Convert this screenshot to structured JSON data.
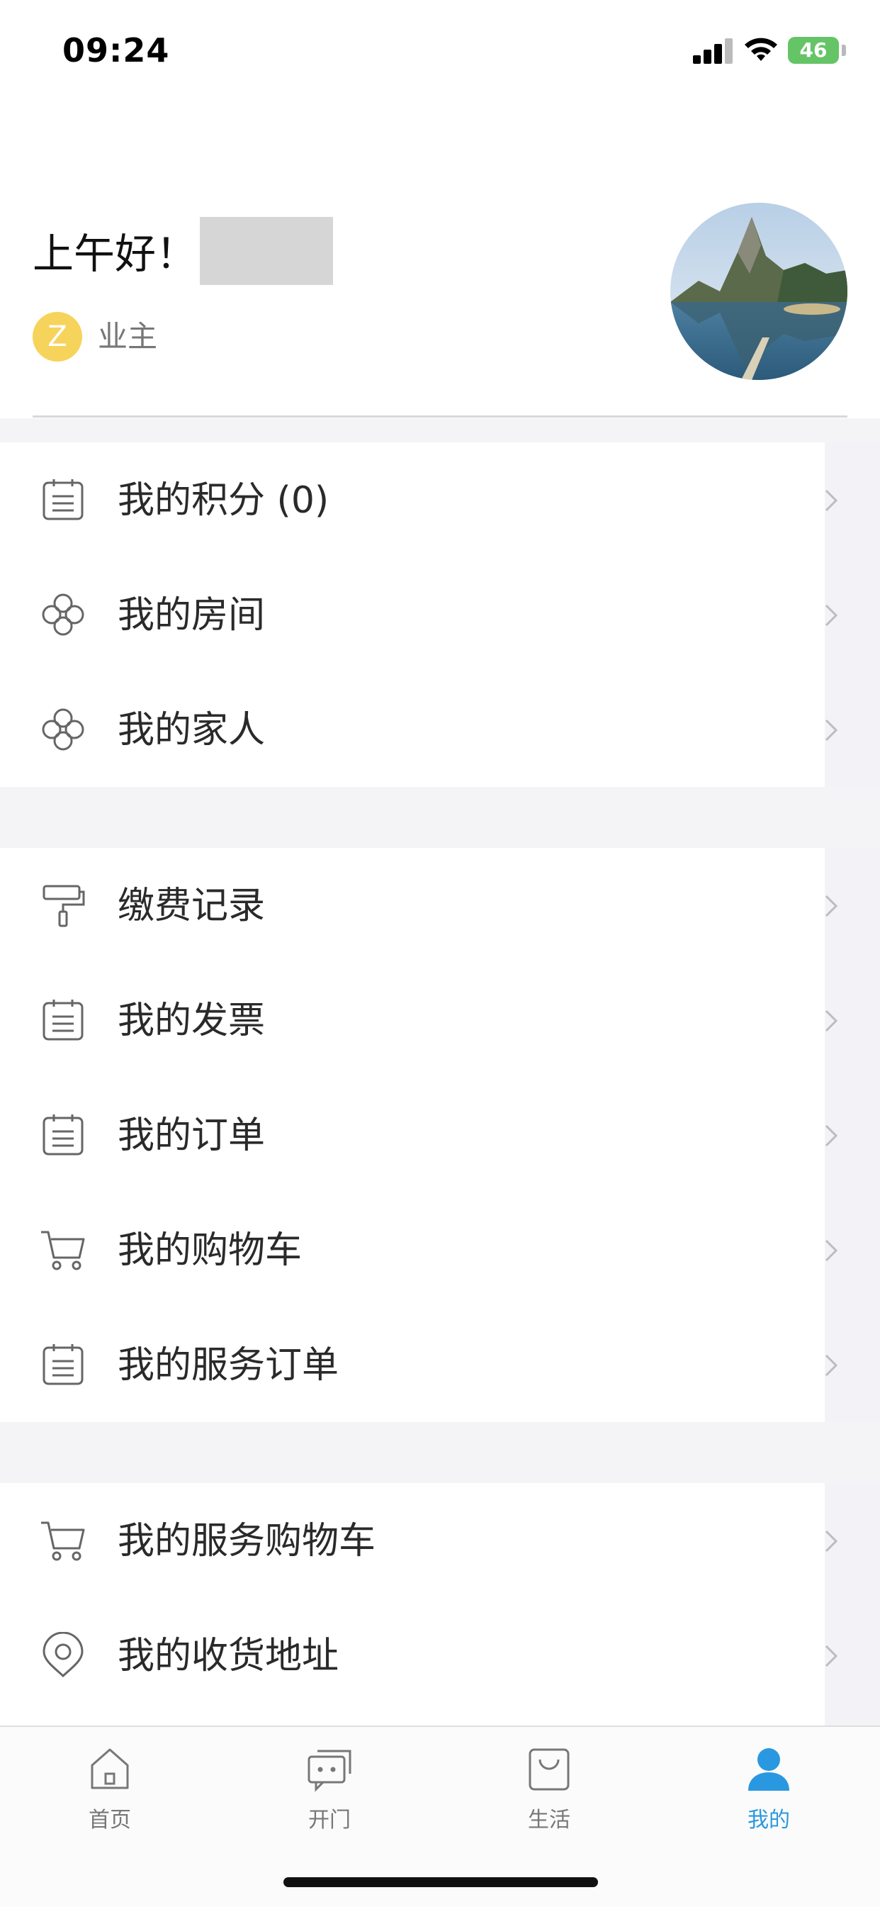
{
  "status_bar": {
    "time": "09:24",
    "battery": "46"
  },
  "header": {
    "greeting": "上午好！",
    "role_badge": "Z",
    "role": "业主"
  },
  "menu": {
    "group1": [
      {
        "icon": "list-icon",
        "label": "我的积分 (0)"
      },
      {
        "icon": "clover-icon",
        "label": "我的房间"
      },
      {
        "icon": "clover-icon",
        "label": "我的家人"
      }
    ],
    "group2": [
      {
        "icon": "paint-roller-icon",
        "label": "缴费记录"
      },
      {
        "icon": "list-icon",
        "label": "我的发票"
      },
      {
        "icon": "list-icon",
        "label": "我的订单"
      },
      {
        "icon": "cart-icon",
        "label": "我的购物车"
      },
      {
        "icon": "list-icon",
        "label": "我的服务订单"
      }
    ],
    "group3": [
      {
        "icon": "cart-icon",
        "label": "我的服务购物车"
      },
      {
        "icon": "location-pin-icon",
        "label": "我的收货地址"
      }
    ]
  },
  "tabbar": {
    "tabs": [
      {
        "icon": "home-icon",
        "label": "首页"
      },
      {
        "icon": "door-chat-icon",
        "label": "开门"
      },
      {
        "icon": "shopping-bag-icon",
        "label": "生活"
      },
      {
        "icon": "user-icon",
        "label": "我的"
      }
    ],
    "active_index": 3
  },
  "colors": {
    "accent": "#2a98e0",
    "badge": "#f6d35a",
    "battery": "#65c466"
  }
}
